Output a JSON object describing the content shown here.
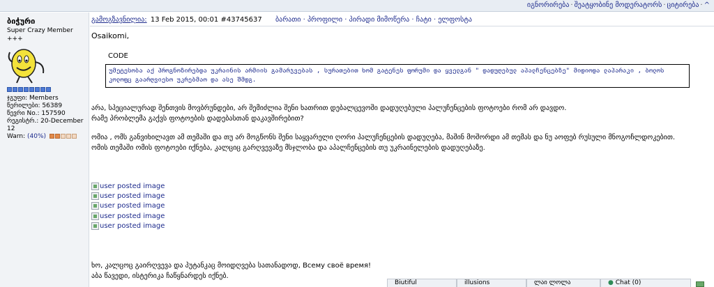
{
  "top_actions": {
    "ignore": "იგნორირება",
    "warn_mod": "შეატყობინე მოდერატორს",
    "quote": "ციტირება",
    "up": "^"
  },
  "author": {
    "name": "ბიჭური",
    "rank": "Super Crazy Member +++",
    "group": "ჯგუფი: Members",
    "posts": "წერილები: 56389",
    "member_no": "წევრი No.: 157590",
    "registered": "რეგისტრ.: 20-December 12",
    "warn_label": "Warn:",
    "warn_value": "(40%)",
    "warn_level": 0.4
  },
  "post_header": {
    "label": "გამოგზავნილია:",
    "date": "13 Feb 2015, 00:01",
    "post_id": "#43745637",
    "tools": "ბარათი · პროფილი · პირადი მიმოწერა · ჩატი · ელფოსტა"
  },
  "post": {
    "greeting": "Osaikomi,",
    "code_label": "CODE",
    "code_text": "უმეტესობა აქ პროგნოზირებდა უკრაინის არმიის გამარჯვებას , სურათებით ხომ გატენეს ფორუმი და ყველგან \" დადუღებულ აპალჩენცებზე\" მიდიოდა ლაპარაკი , ბოლოს კოლოფც გაარღვიესო უკრებმაო და ასე შმდგ.",
    "para1_line1": "არა, სპეციალურად შენთვის მოვბრუნდები, არ შემიძლია შენი ხათრით დებალცევოში დადუღებული პალუჩენცების ფოტოები რომ არ დავდო.",
    "para1_line2": "რამე პრობლემა გაქვს ფოტოების დადებასთან დაკავშირებით?",
    "para2_line1": "ომია , ომს განვიხილავთ ამ თემაში და თუ არ მოგწონს შენი საყვარელი ღორი პალუჩენცების დადუღება, მაშინ მოშორდი ამ თემას და ნუ აოფებ რუსული მნოგოჩლდოკებით.",
    "para2_line2": "ომის თემაში ომის ფოტოები იქნება, კალციც გარღვევაზე მსჯლობა და აპალჩენცების თუ უკრაინელების დადუღებაზე.",
    "images": [
      "user posted image",
      "user posted image",
      "user posted image",
      "user posted image",
      "user posted image"
    ],
    "para3_line1": "ხო, კალცოც გაირღვევა და პუტანკაც მოიდღვება სათანადოდ, Всему своё время!",
    "para3_line2": "აბა წავედი, ისტერიკა ჩაწყნარდეს იქნებ."
  },
  "dock": {
    "tabs": [
      "Biutiful",
      "illusions",
      "ლაი ლოლა",
      "Chat (0)"
    ]
  }
}
